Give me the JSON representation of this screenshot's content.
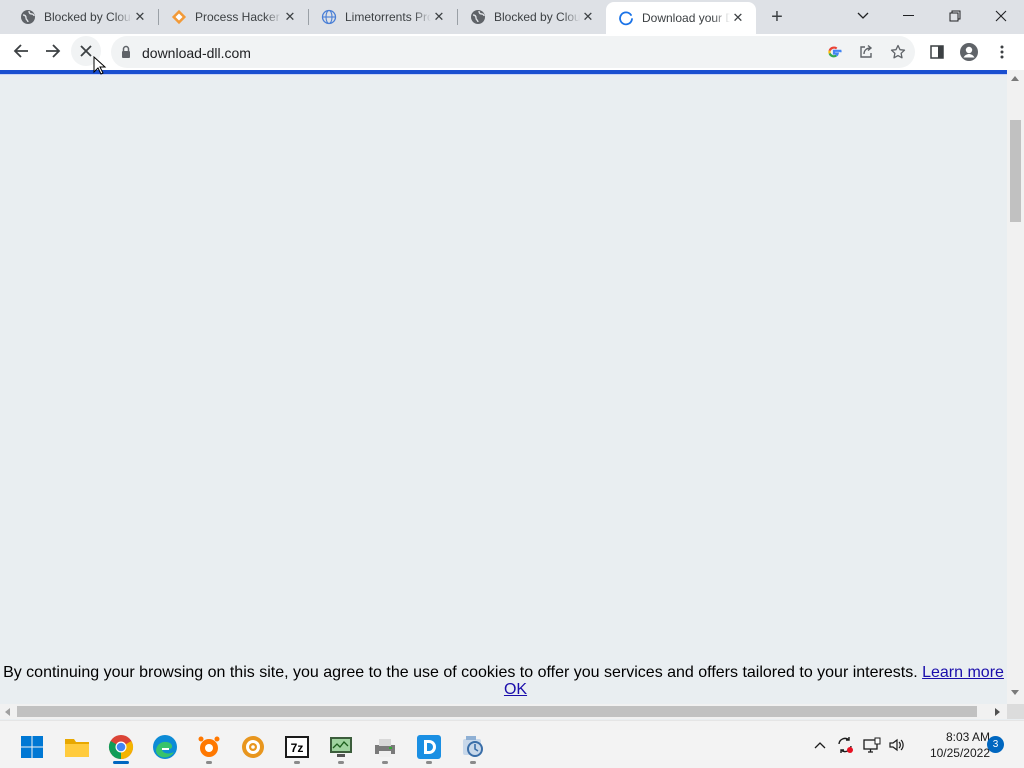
{
  "tabs": [
    {
      "title": "Blocked by Cloudflare",
      "icon": "globe-icon"
    },
    {
      "title": "Process Hacker",
      "icon": "process-hacker-icon"
    },
    {
      "title": "Limetorrents Proxy",
      "icon": "globe-icon"
    },
    {
      "title": "Blocked by Cloudflare",
      "icon": "globe-icon"
    },
    {
      "title": "Download your DLL",
      "icon": "loading-spinner-icon",
      "active": true
    }
  ],
  "address_bar": {
    "url": "download-dll.com"
  },
  "cookie_banner": {
    "message": "By continuing your browsing on this site, you agree to the use of cookies to offer you services and offers tailored to your interests.",
    "learn_more": "Learn more",
    "ok": "OK"
  },
  "taskbar": {
    "apps": [
      "start",
      "file-explorer",
      "chrome",
      "edge",
      "avast",
      "settings-gear",
      "7-zip",
      "network-monitor",
      "device-manager",
      "app-d",
      "system-utility"
    ],
    "time": "8:03 AM",
    "date": "10/25/2022",
    "notification_count": "3"
  },
  "colors": {
    "loading_bar": "#1a4fd0",
    "page_background": "#e9eef1",
    "link": "#1a0dab"
  }
}
